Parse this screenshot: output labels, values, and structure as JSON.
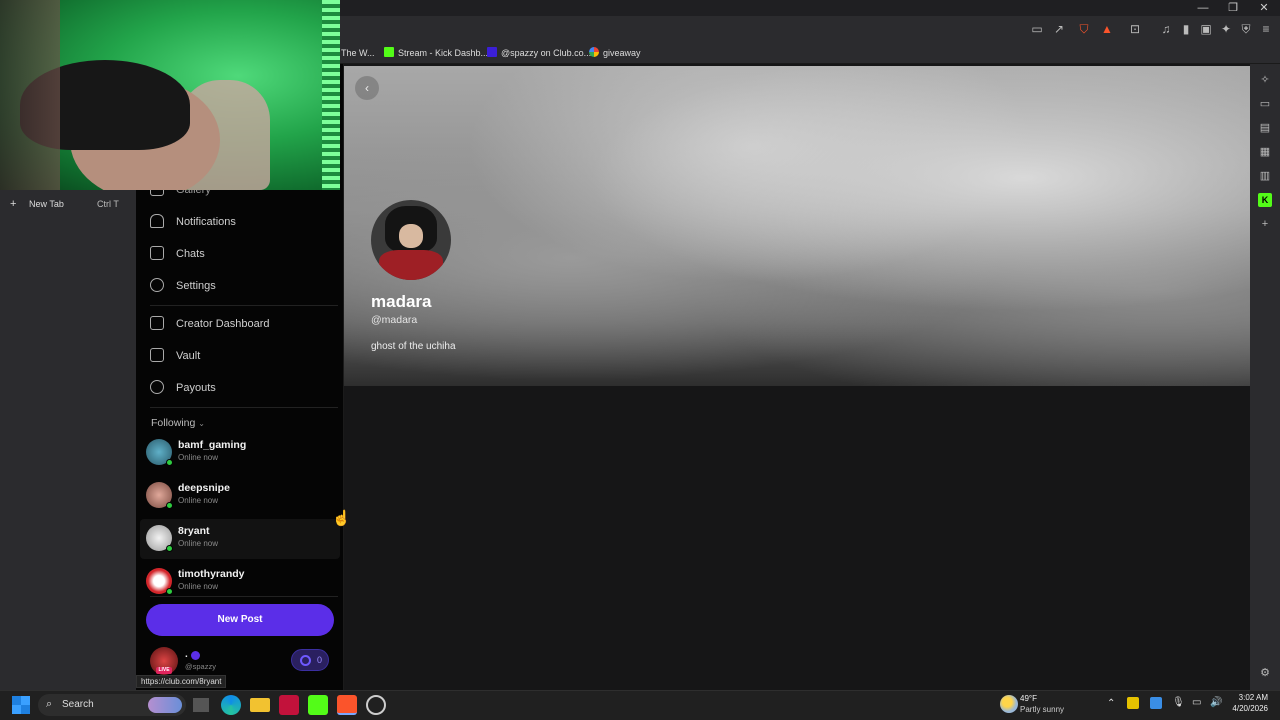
{
  "browser": {
    "bookmarks": [
      {
        "label": "The W...",
        "color": "#888888"
      },
      {
        "label": "Stream - Kick Dashb...",
        "color": "#53fc18"
      },
      {
        "label": "@spazzy on Club.co...",
        "color": "#3b1fd6"
      },
      {
        "label": "giveaway",
        "color": "#ea4335"
      }
    ],
    "new_tab_label": "New Tab",
    "new_tab_shortcut": "Ctrl T",
    "status_url": "https://club.com/8ryant"
  },
  "sidebar": {
    "gallery_label": "Gallery",
    "nav": [
      {
        "label": "Notifications",
        "icon": "bell-icon"
      },
      {
        "label": "Chats",
        "icon": "chat-icon"
      },
      {
        "label": "Settings",
        "icon": "gear-icon"
      }
    ],
    "creator_nav": [
      {
        "label": "Creator Dashboard",
        "icon": "dashboard-icon"
      },
      {
        "label": "Vault",
        "icon": "vault-icon"
      },
      {
        "label": "Payouts",
        "icon": "dollar-icon"
      }
    ],
    "following_label": "Following",
    "following": [
      {
        "name": "bamf_gaming",
        "status": "Online now"
      },
      {
        "name": "deepsnipe",
        "status": "Online now"
      },
      {
        "name": "8ryant",
        "status": "Online now"
      },
      {
        "name": "timothyrandy",
        "status": "Online now"
      }
    ],
    "new_post_label": "New Post",
    "account": {
      "name": ".",
      "handle": "@spazzy",
      "live_badge": "LIVE",
      "coins": "0"
    }
  },
  "profile": {
    "name": "madara",
    "handle": "@madara",
    "bio": "ghost of the uchiha"
  },
  "taskbar": {
    "search_label": "Search",
    "weather_temp": "49°F",
    "weather_desc": "Partly sunny",
    "time": "3:02 AM",
    "date": "4/20/2026"
  },
  "colors": {
    "accent": "#5b2ee8",
    "online": "#2ecc40"
  }
}
